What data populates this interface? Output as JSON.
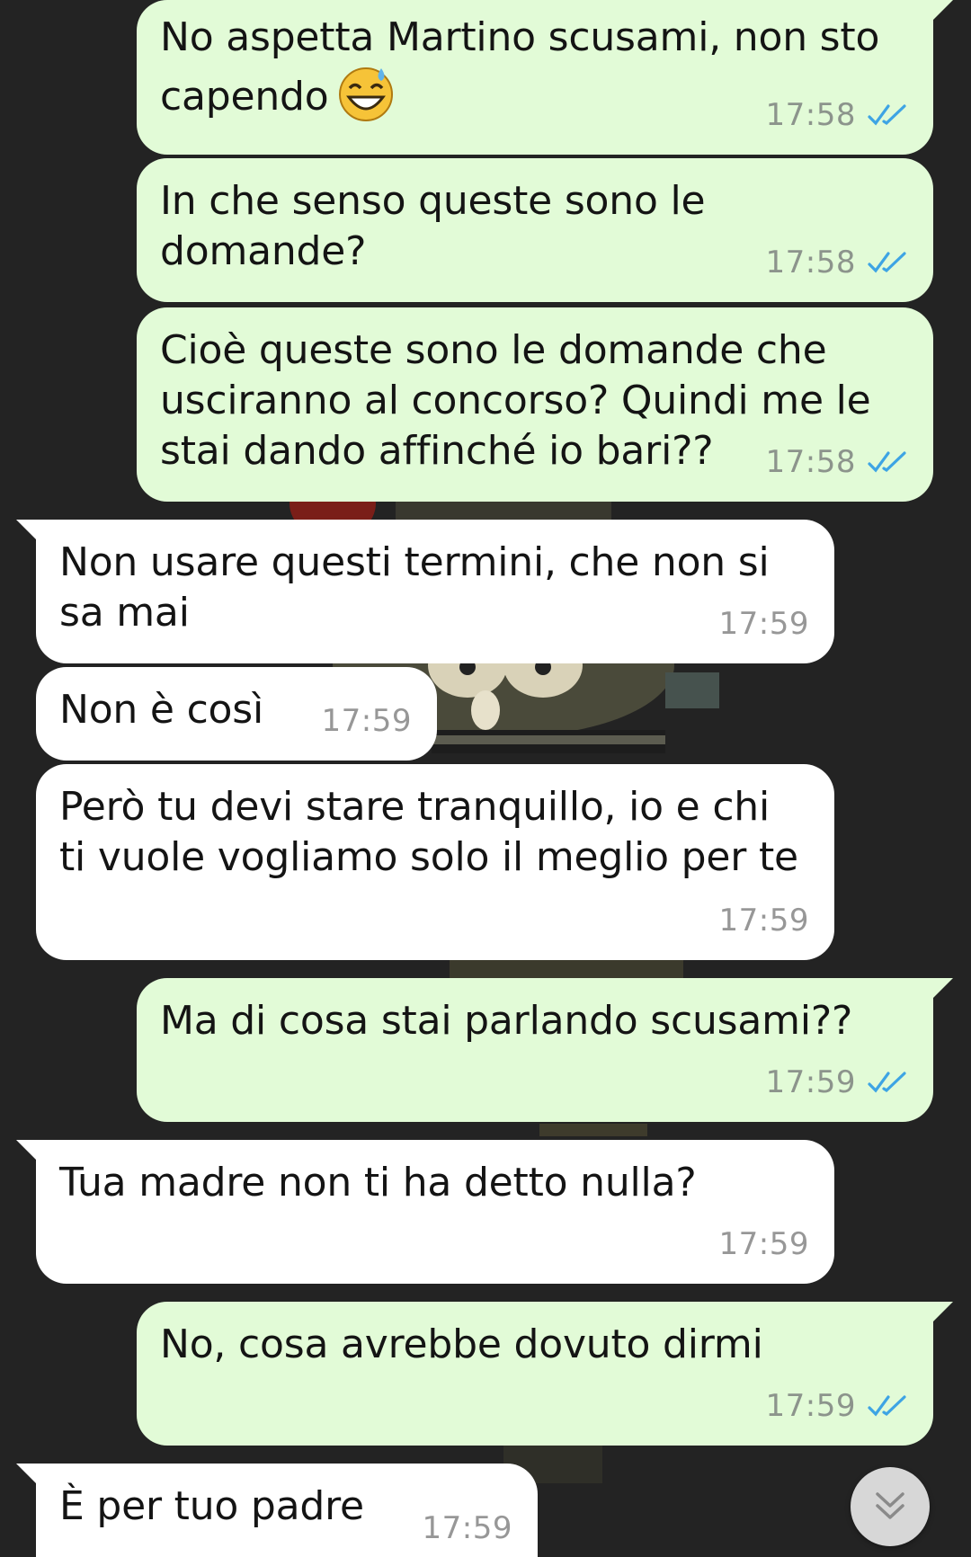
{
  "chat": {
    "messages": [
      {
        "direction": "out",
        "text": "No aspetta Martino scusami, non sto\ncapendo",
        "emoji": "sweat-smile-emoji",
        "time": "17:58",
        "status": "read"
      },
      {
        "direction": "out",
        "text": "In che senso queste sono le\ndomande?",
        "time": "17:58",
        "status": "read"
      },
      {
        "direction": "out",
        "text": "Cioè queste sono le domande che\nusciranno al concorso? Quindi me le\nstai dando affinché io bari??",
        "time": "17:58",
        "status": "read"
      },
      {
        "direction": "in",
        "text": "Non usare questi termini, che non si\nsa mai",
        "time": "17:59"
      },
      {
        "direction": "in",
        "text": "Non è così",
        "time": "17:59"
      },
      {
        "direction": "in",
        "text": "Però tu devi stare tranquillo, io e chi\nti vuole vogliamo solo il meglio per te",
        "time": "17:59"
      },
      {
        "direction": "out",
        "text": "Ma di cosa stai parlando scusami??",
        "time": "17:59",
        "status": "read"
      },
      {
        "direction": "in",
        "text": "Tua madre non ti ha detto nulla?",
        "time": "17:59"
      },
      {
        "direction": "out",
        "text": "No, cosa avrebbe dovuto dirmi",
        "time": "17:59",
        "status": "read"
      }
    ],
    "last_message": {
      "direction": "in",
      "text": "È per tuo padre",
      "time": "17:59"
    }
  },
  "icons": {
    "read_receipt": "double-check-icon",
    "scroll_down": "double-chevron-down-icon",
    "emoji": "sweat-smile-emoji"
  },
  "colors": {
    "background": "#232323",
    "outgoing_bubble": "#e2fbd7",
    "incoming_bubble": "#ffffff",
    "read_ticks": "#3ea4e4",
    "timestamp": "#8c948c",
    "scroll_button": "#d7d7d7"
  }
}
